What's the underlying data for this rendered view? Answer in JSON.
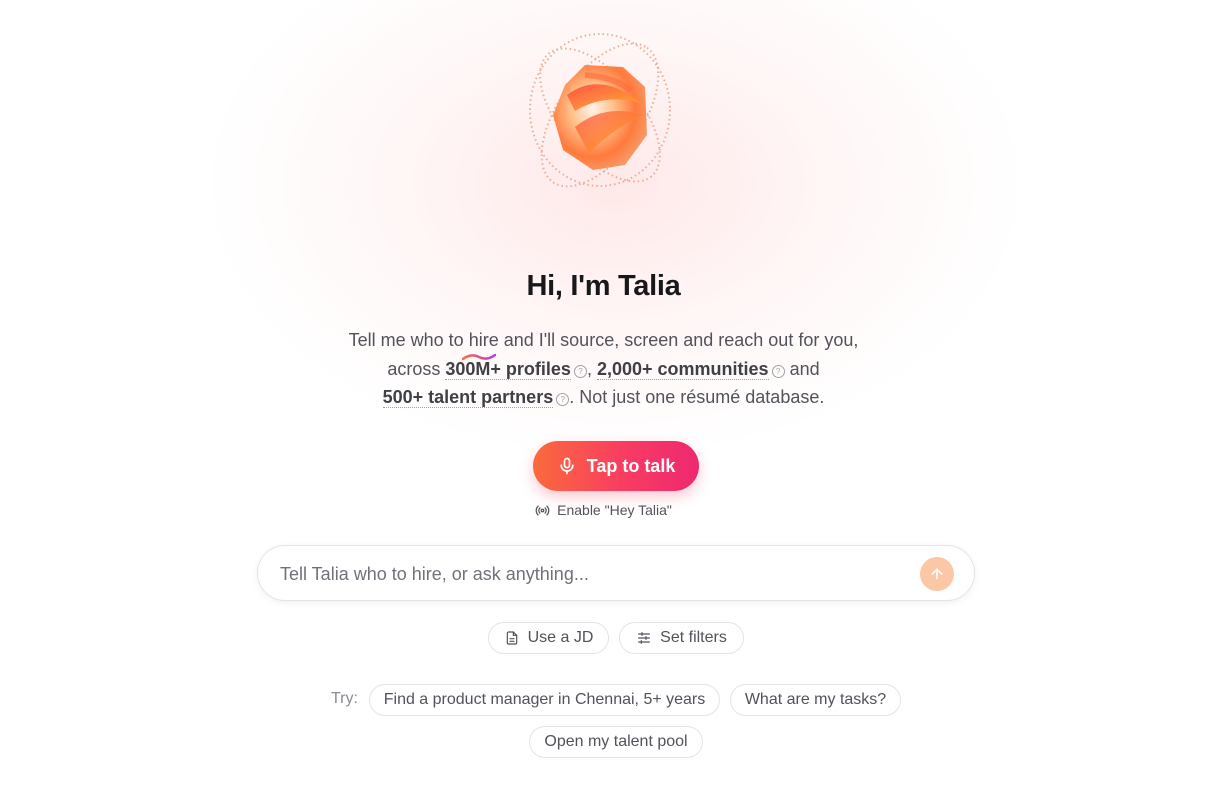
{
  "hero": {
    "title": "Hi, I'm Talia",
    "line1": "Tell me who to hire and I'll source, screen and reach out for you,",
    "across": "across",
    "profiles": "300M+ profiles",
    "comma": ",",
    "communities": "2,000+ communities",
    "and": "and",
    "partners": "500+ talent partners",
    "suffix": ". Not just one résumé database."
  },
  "voice": {
    "tap_label": "Tap to talk",
    "hey_label": "Enable \"Hey Talia\""
  },
  "prompt": {
    "placeholder": "Tell Talia who to hire, or ask anything..."
  },
  "actions": {
    "use_jd": "Use a JD",
    "set_filters": "Set filters"
  },
  "suggestions": {
    "label": "Try:",
    "items": [
      "Find a product manager in Chennai, 5+ years",
      "What are my tasks?",
      "Open my talent pool"
    ]
  },
  "colors": {
    "accent_start": "#fb6a3c",
    "accent_end": "#ee2870",
    "send_button": "#fbc7a4"
  },
  "icons": {
    "talk": "microphone-icon",
    "hey": "broadcast-icon",
    "send": "arrow-up-icon",
    "use_jd": "document-icon",
    "set_filters": "sliders-icon",
    "help": "help-circle-icon"
  }
}
